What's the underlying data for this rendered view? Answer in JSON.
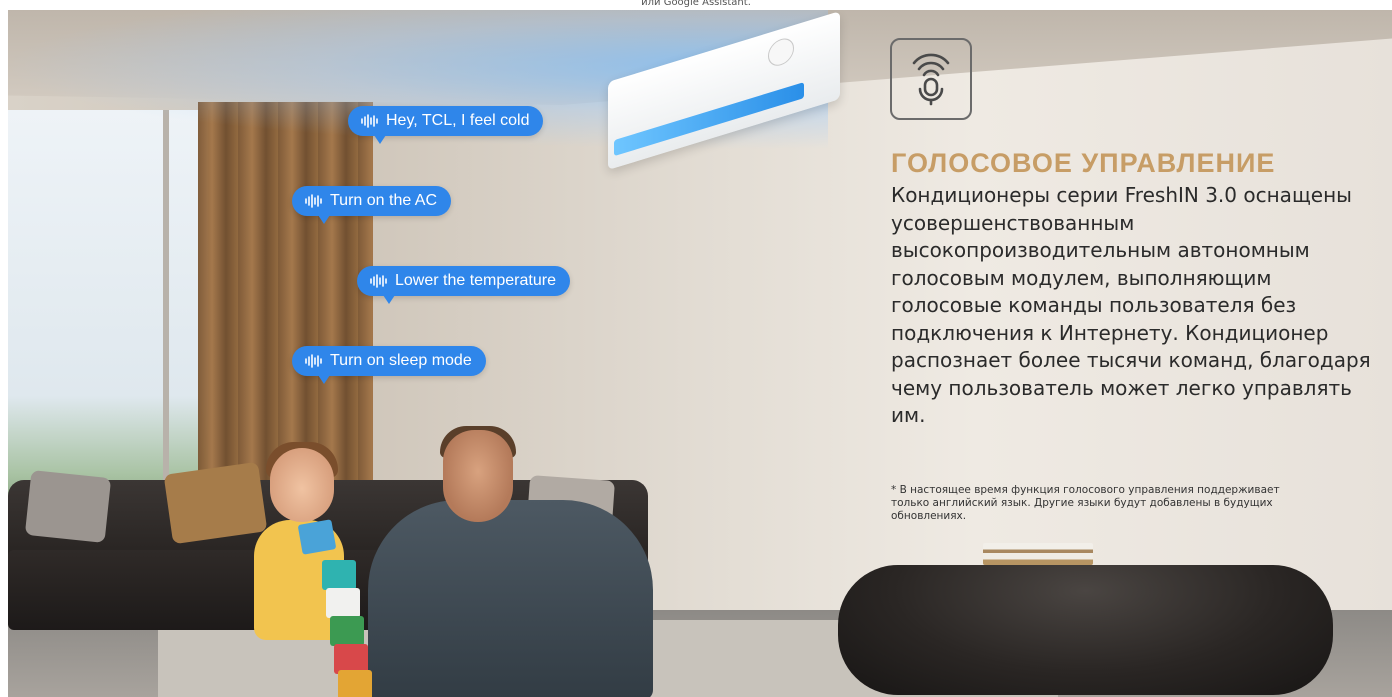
{
  "top_caption": "или Google Assistant.",
  "bubbles": [
    {
      "label": "Hey, TCL, I feel cold"
    },
    {
      "label": "Turn on the AC"
    },
    {
      "label": "Lower the temperature"
    },
    {
      "label": "Turn on sleep mode"
    }
  ],
  "feature": {
    "icon": "microphone-wifi-icon",
    "heading": "ГОЛОСОВОЕ УПРАВЛЕНИЕ",
    "description": "Кондиционеры серии FreshIN 3.0 оснащены усовершенствованным высокопроизводительным автономным голосовым модулем, выполняющим голосовые команды пользователя без подключения к Интернету. Кондиционер распознает более тысячи команд, благодаря чему пользователь может легко управлять им.",
    "footnote": "* В настоящее время функция голосового управления поддерживает только английский язык. Другие языки будут добавлены в будущих обновлениях."
  },
  "colors": {
    "bubble": "#2f86ea",
    "heading": "#c79d66",
    "text": "#2b2b2b"
  }
}
